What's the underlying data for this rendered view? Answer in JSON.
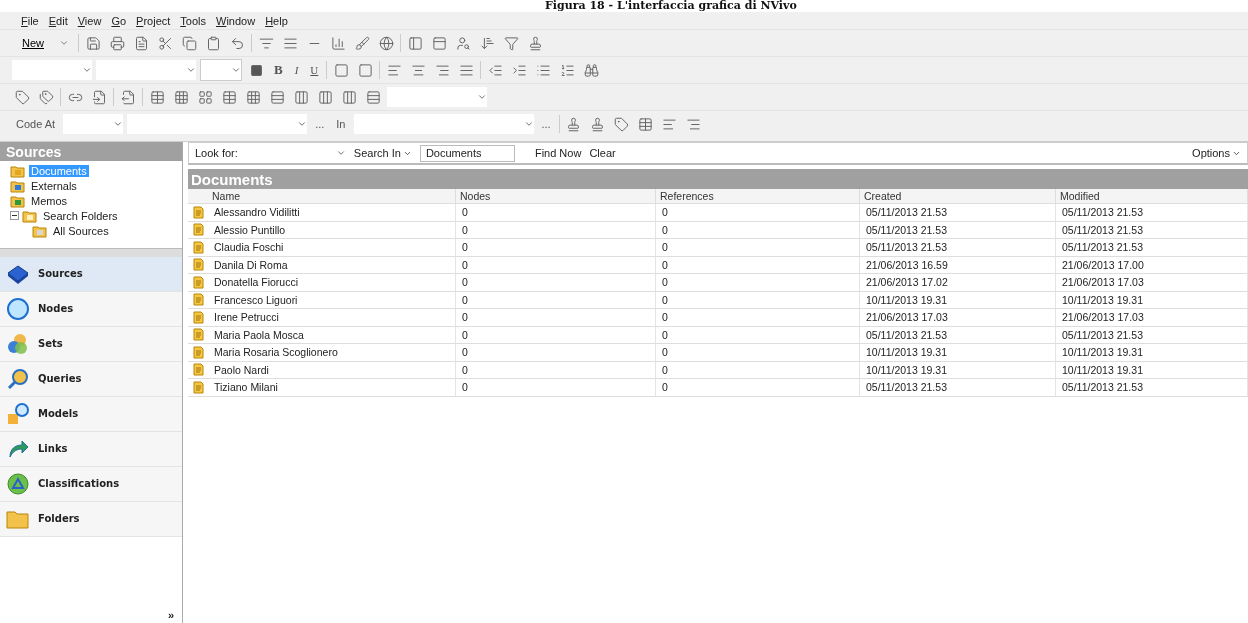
{
  "caption": "Figura 18 - L'interfaccia grafica di NVivo",
  "menu": [
    {
      "label": "File"
    },
    {
      "label": "Edit"
    },
    {
      "label": "View"
    },
    {
      "label": "Go"
    },
    {
      "label": "Project"
    },
    {
      "label": "Tools"
    },
    {
      "label": "Window"
    },
    {
      "label": "Help"
    }
  ],
  "toolbar": {
    "new_button": "New",
    "format_buttons": [
      "B",
      "I",
      "U"
    ],
    "code_at_label": "Code At",
    "ellipsis_1": "...",
    "in_label": "In",
    "ellipsis_2": "..."
  },
  "sidebar": {
    "title": "Sources",
    "tree": [
      {
        "label": "Documents",
        "selected": true,
        "kind": "documents"
      },
      {
        "label": "Externals",
        "selected": false,
        "kind": "externals"
      },
      {
        "label": "Memos",
        "selected": false,
        "kind": "memos"
      },
      {
        "label": "Search Folders",
        "selected": false,
        "kind": "search",
        "expanded": true,
        "children": [
          {
            "label": "All Sources",
            "selected": false,
            "kind": "all"
          }
        ]
      }
    ],
    "nav": [
      {
        "label": "Sources",
        "selected": true,
        "kind": "sources"
      },
      {
        "label": "Nodes",
        "selected": false,
        "kind": "nodes"
      },
      {
        "label": "Sets",
        "selected": false,
        "kind": "sets"
      },
      {
        "label": "Queries",
        "selected": false,
        "kind": "queries"
      },
      {
        "label": "Models",
        "selected": false,
        "kind": "models"
      },
      {
        "label": "Links",
        "selected": false,
        "kind": "links"
      },
      {
        "label": "Classifications",
        "selected": false,
        "kind": "classifications"
      },
      {
        "label": "Folders",
        "selected": false,
        "kind": "folders"
      }
    ],
    "more": "»"
  },
  "find_bar": {
    "look_for_label": "Look for:",
    "search_in": "Search In",
    "search_in_value": "Documents",
    "find_now": "Find Now",
    "clear": "Clear",
    "options": "Options"
  },
  "table": {
    "title": "Documents",
    "columns": [
      "Name",
      "Nodes",
      "References",
      "Created",
      "Modified"
    ],
    "rows": [
      [
        "Alessandro Vidilitti",
        "0",
        "0",
        "05/11/2013 21.53",
        "05/11/2013 21.53"
      ],
      [
        "Alessio Puntillo",
        "0",
        "0",
        "05/11/2013 21.53",
        "05/11/2013 21.53"
      ],
      [
        "Claudia Foschi",
        "0",
        "0",
        "05/11/2013 21.53",
        "05/11/2013 21.53"
      ],
      [
        "Danila Di Roma",
        "0",
        "0",
        "21/06/2013 16.59",
        "21/06/2013 17.00"
      ],
      [
        "Donatella Fiorucci",
        "0",
        "0",
        "21/06/2013 17.02",
        "21/06/2013 17.03"
      ],
      [
        "Francesco Liguori",
        "0",
        "0",
        "10/11/2013 19.31",
        "10/11/2013 19.31"
      ],
      [
        "Irene Petrucci",
        "0",
        "0",
        "21/06/2013 17.03",
        "21/06/2013 17.03"
      ],
      [
        "Maria Paola Mosca",
        "0",
        "0",
        "05/11/2013 21.53",
        "05/11/2013 21.53"
      ],
      [
        "Maria Rosaria Scoglionero",
        "0",
        "0",
        "10/11/2013 19.31",
        "10/11/2013 19.31"
      ],
      [
        "Paolo Nardi",
        "0",
        "0",
        "10/11/2013 19.31",
        "10/11/2013 19.31"
      ],
      [
        "Tiziano Milani",
        "0",
        "0",
        "05/11/2013 21.53",
        "05/11/2013 21.53"
      ]
    ]
  }
}
